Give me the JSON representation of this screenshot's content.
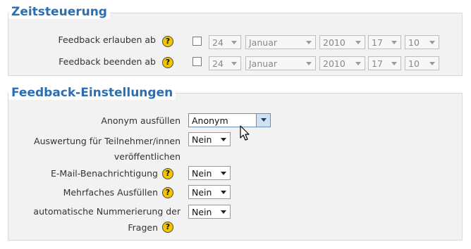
{
  "timing": {
    "title": "Zeitsteuerung",
    "rows": [
      {
        "label": "Feedback erlauben ab",
        "day": "24",
        "month": "Januar",
        "year": "2010",
        "hour": "17",
        "minute": "10"
      },
      {
        "label": "Feedback beenden ab",
        "day": "24",
        "month": "Januar",
        "year": "2010",
        "hour": "17",
        "minute": "10"
      }
    ]
  },
  "settings": {
    "title": "Feedback-Einstellungen",
    "anonym": {
      "label": "Anonym ausfüllen",
      "value": "Anonym"
    },
    "publish": {
      "label_line1": "Auswertung für Teilnehmer/innen",
      "label_line2": "veröffentlichen",
      "value": "Nein"
    },
    "email": {
      "label": "E-Mail-Benachrichtigung",
      "value": "Nein"
    },
    "multiple": {
      "label": "Mehrfaches Ausfüllen",
      "value": "Nein"
    },
    "numbering": {
      "label_line1": "automatische Nummerierung der",
      "label_line2": "Fragen",
      "value": "Nein"
    }
  },
  "icons": {
    "help": "help-icon",
    "cursor": "mouse-pointer-icon"
  },
  "colors": {
    "legend": "#2a6fb3",
    "help": "#f5c400",
    "section_bg": "#f2f2f2"
  }
}
